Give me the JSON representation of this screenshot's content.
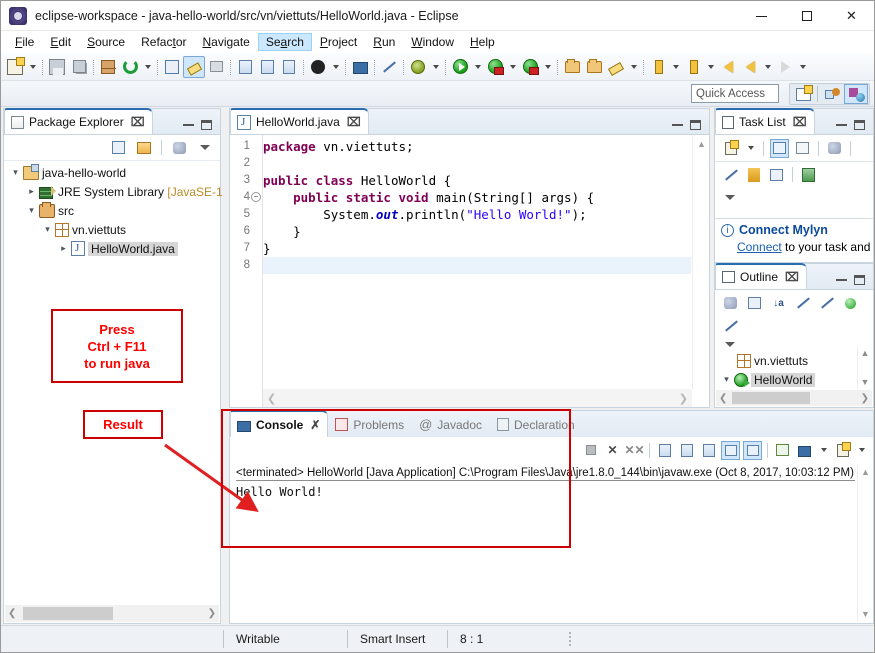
{
  "window": {
    "title": "eclipse-workspace - java-hello-world/src/vn/viettuts/HelloWorld.java - Eclipse",
    "app_icon": "eclipse-icon",
    "minimize_label": "Minimize",
    "maximize_label": "Maximize",
    "close_label": "Close"
  },
  "menubar": {
    "items": [
      {
        "label": "File",
        "mnemonic": "F",
        "active": false
      },
      {
        "label": "Edit",
        "mnemonic": "E",
        "active": false
      },
      {
        "label": "Source",
        "mnemonic": "S",
        "active": false
      },
      {
        "label": "Refactor",
        "mnemonic": "t",
        "active": false
      },
      {
        "label": "Navigate",
        "mnemonic": "N",
        "active": false
      },
      {
        "label": "Search",
        "mnemonic": "a",
        "active": true
      },
      {
        "label": "Project",
        "mnemonic": "P",
        "active": false
      },
      {
        "label": "Run",
        "mnemonic": "R",
        "active": false
      },
      {
        "label": "Window",
        "mnemonic": "W",
        "active": false
      },
      {
        "label": "Help",
        "mnemonic": "H",
        "active": false
      }
    ]
  },
  "toolbar": {
    "items": [
      {
        "name": "new-wizard",
        "icon": "new-document-icon",
        "dropdown": true
      },
      {
        "name": "save",
        "icon": "save-icon",
        "dropdown": false
      },
      {
        "name": "save-all",
        "icon": "save-all-icon",
        "dropdown": false
      },
      {
        "name": "new-java-package",
        "icon": "new-package-icon",
        "dropdown": false
      },
      {
        "name": "refresh-build",
        "icon": "build-refresh-icon",
        "dropdown": true
      },
      {
        "name": "new-java-project",
        "icon": "new-java-project-icon",
        "dropdown": false
      },
      {
        "name": "toggle-mark-occurrences",
        "icon": "highlighter-icon",
        "dropdown": false,
        "selected": true
      },
      {
        "name": "skip-breakpoints",
        "icon": "skip-breakpoints-icon",
        "dropdown": false
      },
      {
        "name": "open-task",
        "icon": "open-task-icon",
        "dropdown": false
      },
      {
        "name": "open-type",
        "icon": "open-type-icon",
        "dropdown": false
      },
      {
        "name": "paragraph-marks",
        "icon": "pilcrow-icon",
        "dropdown": false
      },
      {
        "name": "user",
        "icon": "person-icon",
        "dropdown": true
      },
      {
        "name": "terminal",
        "icon": "monitor-icon",
        "dropdown": false
      },
      {
        "name": "no-pen",
        "icon": "pen-disabled-icon",
        "dropdown": false
      },
      {
        "name": "external-tools",
        "icon": "bug-tools-icon",
        "dropdown": true
      },
      {
        "name": "run",
        "icon": "run-icon",
        "dropdown": true
      },
      {
        "name": "debug",
        "icon": "debug-icon",
        "dropdown": true
      },
      {
        "name": "coverage",
        "icon": "coverage-icon",
        "dropdown": true
      },
      {
        "name": "open-resource",
        "icon": "open-folder-icon",
        "dropdown": false
      },
      {
        "name": "open-folder",
        "icon": "folder-icon",
        "dropdown": false
      },
      {
        "name": "pencil",
        "icon": "pencil-icon",
        "dropdown": true
      },
      {
        "name": "next-annotation",
        "icon": "arrow-down-icon",
        "dropdown": true
      },
      {
        "name": "previous-annotation",
        "icon": "arrow-up-icon",
        "dropdown": true
      },
      {
        "name": "last-edit-location",
        "icon": "back-star-icon",
        "dropdown": false
      },
      {
        "name": "back",
        "icon": "back-arrow-icon",
        "dropdown": true
      },
      {
        "name": "forward",
        "icon": "forward-arrow-icon",
        "dropdown": true
      }
    ]
  },
  "quick_access": {
    "placeholder": "Quick Access",
    "value": "",
    "buttons": [
      {
        "name": "open-perspective",
        "icon": "open-perspective-icon",
        "selected": false
      },
      {
        "name": "perspective-project-explorer",
        "icon": "project-explorer-perspective-icon",
        "selected": false
      },
      {
        "name": "perspective-java",
        "icon": "java-perspective-icon",
        "selected": true
      }
    ]
  },
  "package_explorer": {
    "tab_label": "Package Explorer",
    "tab_icon": "package-explorer-icon",
    "close_label": "⌧",
    "toolbar": [
      {
        "name": "collapse-all",
        "icon": "collapse-all-icon"
      },
      {
        "name": "link-with-editor",
        "icon": "link-editor-icon"
      },
      {
        "name": "view-menu-filters",
        "icon": "filters-icon"
      },
      {
        "name": "view-menu",
        "icon": "view-menu-icon"
      }
    ],
    "tree": [
      {
        "label": "java-hello-world",
        "icon": "java-project-icon",
        "depth": 0,
        "twisty": "open",
        "selected": false
      },
      {
        "label": "JRE System Library [JavaSE-1",
        "icon": "jre-library-icon",
        "depth": 1,
        "twisty": "closed",
        "selected": false
      },
      {
        "label": "src",
        "icon": "source-folder-icon",
        "depth": 1,
        "twisty": "open",
        "selected": false
      },
      {
        "label": "vn.viettuts",
        "icon": "package-icon",
        "depth": 2,
        "twisty": "open",
        "selected": false
      },
      {
        "label": "HelloWorld.java",
        "icon": "java-file-icon",
        "depth": 3,
        "twisty": "closed",
        "selected": true
      }
    ]
  },
  "editor": {
    "tab_label": "HelloWorld.java",
    "tab_icon": "java-file-icon",
    "close_label": "⌧",
    "current_line": 8,
    "lines": [
      {
        "no": 1,
        "folding": false,
        "tokens": [
          {
            "t": "package ",
            "c": "kw"
          },
          {
            "t": "vn.viettuts;",
            "c": ""
          }
        ]
      },
      {
        "no": 2,
        "folding": false,
        "tokens": []
      },
      {
        "no": 3,
        "folding": false,
        "tokens": [
          {
            "t": "public class ",
            "c": "kw"
          },
          {
            "t": "HelloWorld {",
            "c": ""
          }
        ]
      },
      {
        "no": 4,
        "folding": true,
        "tokens": [
          {
            "t": "    ",
            "c": ""
          },
          {
            "t": "public static void ",
            "c": "kw"
          },
          {
            "t": "main(String[] args) {",
            "c": ""
          }
        ]
      },
      {
        "no": 5,
        "folding": false,
        "tokens": [
          {
            "t": "        System.",
            "c": ""
          },
          {
            "t": "out",
            "c": "fld"
          },
          {
            "t": ".println(",
            "c": ""
          },
          {
            "t": "\"Hello World!\"",
            "c": "str"
          },
          {
            "t": ");",
            "c": ""
          }
        ]
      },
      {
        "no": 6,
        "folding": false,
        "tokens": [
          {
            "t": "    }",
            "c": ""
          }
        ]
      },
      {
        "no": 7,
        "folding": false,
        "tokens": [
          {
            "t": "}",
            "c": ""
          }
        ]
      },
      {
        "no": 8,
        "folding": false,
        "tokens": []
      }
    ]
  },
  "task_list": {
    "tab_label": "Task List",
    "tab_icon": "task-list-icon",
    "close_label": "⌧",
    "toolbar_row1": [
      {
        "name": "new-task",
        "icon": "new-task-icon",
        "dropdown": true
      },
      {
        "name": "categorized-presentation",
        "icon": "categorized-icon",
        "selected": true
      },
      {
        "name": "scheduled-presentation",
        "icon": "scheduled-icon",
        "selected": false
      },
      {
        "name": "focus-on-workweek",
        "icon": "focus-workweek-icon",
        "selected": false
      }
    ],
    "toolbar_row2": [
      {
        "name": "synchronize-changed",
        "icon": "synchronize-icon"
      },
      {
        "name": "show-uncompleted",
        "icon": "uncompleted-icon"
      },
      {
        "name": "collapse-all",
        "icon": "collapse-all-icon"
      },
      {
        "name": "restore-tasks",
        "icon": "restore-tasks-icon"
      },
      {
        "name": "view-menu",
        "icon": "view-menu-icon"
      }
    ],
    "notice": {
      "icon": "info-icon",
      "heading": "Connect Mylyn",
      "link_text": "Connect",
      "body_text": " to your task and"
    }
  },
  "outline": {
    "tab_label": "Outline",
    "tab_icon": "outline-icon",
    "close_label": "⌧",
    "toolbar": [
      {
        "name": "focus-on-active-task",
        "icon": "focus-task-icon"
      },
      {
        "name": "collapse-all",
        "icon": "collapse-all-icon"
      },
      {
        "name": "sort",
        "icon": "sort-az-icon"
      },
      {
        "name": "hide-fields",
        "icon": "hide-fields-icon"
      },
      {
        "name": "hide-static",
        "icon": "hide-static-icon"
      },
      {
        "name": "hide-non-public",
        "icon": "hide-nonpublic-icon"
      },
      {
        "name": "hide-local-types",
        "icon": "hide-local-icon"
      },
      {
        "name": "view-menu",
        "icon": "view-menu-icon"
      }
    ],
    "tree": [
      {
        "label": "vn.viettuts",
        "icon": "package-icon",
        "depth": 1,
        "twisty": "none",
        "selected": false
      },
      {
        "label": "HelloWorld",
        "icon": "java-class-icon",
        "depth": 0,
        "twisty": "open",
        "selected": true
      }
    ]
  },
  "console": {
    "tabs": [
      {
        "label": "Console",
        "icon": "console-icon",
        "active": true,
        "closeable": true
      },
      {
        "label": "Problems",
        "icon": "problems-icon",
        "active": false,
        "closeable": false
      },
      {
        "label": "Javadoc",
        "icon": "javadoc-icon",
        "active": false,
        "closeable": false
      },
      {
        "label": "Declaration",
        "icon": "declaration-icon",
        "active": false,
        "closeable": false
      }
    ],
    "toolbar": [
      {
        "name": "terminate",
        "icon": "terminate-icon"
      },
      {
        "name": "remove-launch",
        "icon": "remove-launch-icon"
      },
      {
        "name": "remove-all-terminated",
        "icon": "remove-all-icon"
      },
      {
        "name": "clear-console",
        "icon": "clear-console-icon"
      },
      {
        "name": "scroll-lock",
        "icon": "scroll-lock-icon"
      },
      {
        "name": "word-wrap",
        "icon": "word-wrap-icon"
      },
      {
        "name": "show-console-on-output",
        "icon": "show-on-output-icon",
        "selected": true
      },
      {
        "name": "show-console-on-error",
        "icon": "show-on-error-icon",
        "selected": true
      },
      {
        "name": "pin-console",
        "icon": "pin-console-icon"
      },
      {
        "name": "display-selected-console",
        "icon": "display-console-icon",
        "dropdown": true
      },
      {
        "name": "open-console",
        "icon": "open-console-icon",
        "dropdown": true
      }
    ],
    "header_line": "<terminated> HelloWorld [Java Application] C:\\Program Files\\Java\\jre1.8.0_144\\bin\\javaw.exe (Oct 8, 2017, 10:03:12 PM)",
    "output": "Hello World!"
  },
  "statusbar": {
    "writable": "Writable",
    "insert_mode": "Smart Insert",
    "cursor_position": "8 : 1"
  },
  "annotations": {
    "accent_color": "#cc0000",
    "text_color": "#ff0000",
    "run_hint": {
      "line1": "Press",
      "line2": "Ctrl + F11",
      "line3": "to run java"
    },
    "result_label": "Result"
  }
}
